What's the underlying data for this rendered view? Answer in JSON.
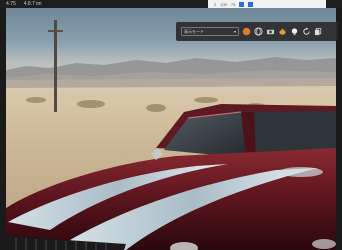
{
  "titlebar": {
    "menu_items": [
      "4.75",
      "4.8.7 im"
    ]
  },
  "statusbar": {
    "items": [
      "2",
      "100",
      "75"
    ]
  },
  "toolbar": {
    "dropdown_value": "表示モード",
    "dropdown_arrow": "▾"
  },
  "icons": [
    "material-ball-icon",
    "globe-icon",
    "camera-icon",
    "teapot-icon",
    "light-icon",
    "rotate-icon",
    "copy-icon"
  ]
}
